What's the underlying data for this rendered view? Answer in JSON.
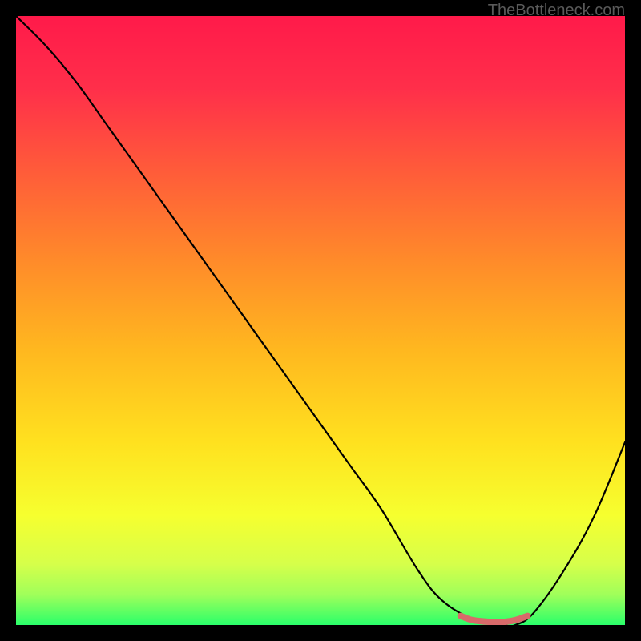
{
  "watermark": "TheBottleneck.com",
  "chart_data": {
    "type": "line",
    "title": "",
    "xlabel": "",
    "ylabel": "",
    "xlim": [
      0,
      100
    ],
    "ylim": [
      0,
      100
    ],
    "grid": false,
    "series": [
      {
        "name": "bottleneck-curve",
        "x": [
          0,
          5,
          10,
          15,
          20,
          25,
          30,
          35,
          40,
          45,
          50,
          55,
          60,
          66,
          70,
          75,
          80,
          82,
          85,
          90,
          95,
          100
        ],
        "values": [
          100,
          95,
          89,
          82,
          75,
          68,
          61,
          54,
          47,
          40,
          33,
          26,
          19,
          9,
          4,
          1,
          0,
          0,
          2,
          9,
          18,
          30
        ]
      },
      {
        "name": "target-range-marker",
        "x": [
          73,
          75,
          78,
          80,
          82,
          84
        ],
        "values": [
          1.5,
          0.8,
          0.5,
          0.5,
          0.8,
          1.5
        ]
      }
    ],
    "gradient_stops": [
      {
        "offset": 0.0,
        "color": "#ff1a4a"
      },
      {
        "offset": 0.12,
        "color": "#ff2f4a"
      },
      {
        "offset": 0.25,
        "color": "#ff5a3a"
      },
      {
        "offset": 0.4,
        "color": "#ff8a2a"
      },
      {
        "offset": 0.55,
        "color": "#ffb81f"
      },
      {
        "offset": 0.7,
        "color": "#ffe11f"
      },
      {
        "offset": 0.82,
        "color": "#f6ff2f"
      },
      {
        "offset": 0.9,
        "color": "#d6ff4a"
      },
      {
        "offset": 0.95,
        "color": "#a0ff5a"
      },
      {
        "offset": 1.0,
        "color": "#2aff6a"
      }
    ],
    "marker_color": "#d86a6a"
  }
}
